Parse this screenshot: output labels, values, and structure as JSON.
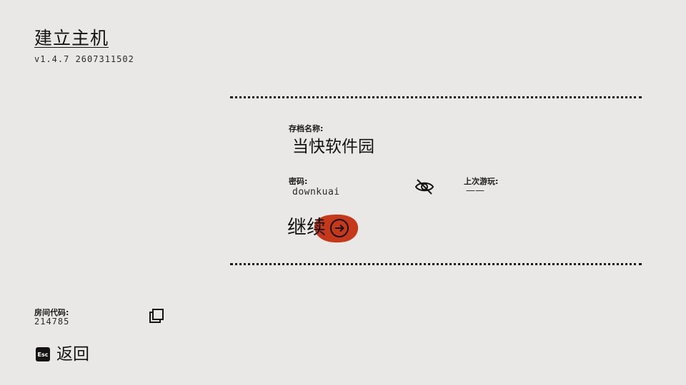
{
  "header": {
    "title": "建立主机",
    "version": "v1.4.7 2607311502"
  },
  "save_panel": {
    "save_name_label": "存档名称:",
    "save_name": "当快软件园",
    "password_label": "密码:",
    "password": "downkuai",
    "password_visibility_icon": "eye-slash-icon",
    "last_played_label": "上次游玩:",
    "last_played": "——",
    "continue_label": "继续",
    "continue_icon": "arrow-right-circle-icon"
  },
  "room": {
    "code_label": "房间代码:",
    "code": "214785",
    "copy_icon": "copy-icon"
  },
  "footer": {
    "esc_key": "Esc",
    "back_label": "返回"
  },
  "colors": {
    "background": "#e9e8e6",
    "text": "#141414",
    "accent": "#c5391a"
  }
}
